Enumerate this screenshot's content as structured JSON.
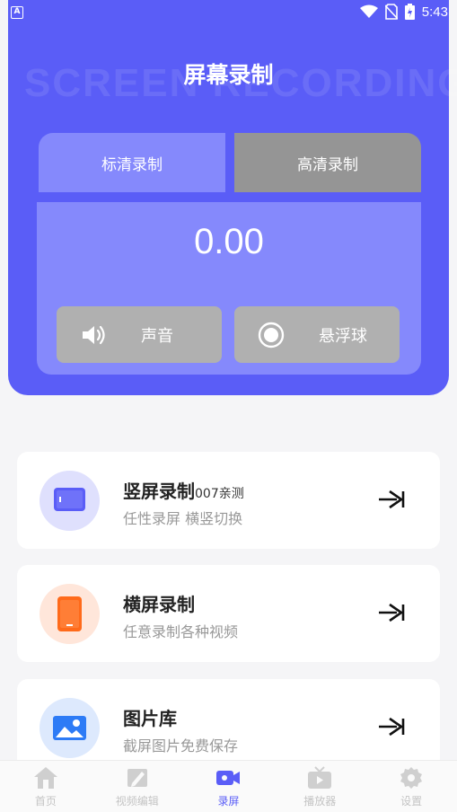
{
  "status_bar": {
    "left_badge": "A",
    "time": "5:43"
  },
  "header": {
    "watermark": "SCREEN RECORDING",
    "title": "屏幕录制",
    "tabs": {
      "sd": "标清录制",
      "hd": "高清录制"
    },
    "timer": "0.00",
    "buttons": {
      "sound": "声音",
      "float": "悬浮球"
    }
  },
  "cards": [
    {
      "title": "竖屏录制",
      "title_suffix": "007亲测",
      "subtitle": "任性录屏 横竖切换",
      "icon": "portrait-screen-icon"
    },
    {
      "title": "横屏录制",
      "subtitle": "任意录制各种视频",
      "icon": "landscape-phone-icon"
    },
    {
      "title": "图片库",
      "subtitle": "截屏图片免费保存",
      "icon": "image-gallery-icon"
    }
  ],
  "nav": [
    {
      "label": "首页",
      "icon": "home-icon"
    },
    {
      "label": "视频编辑",
      "icon": "edit-icon"
    },
    {
      "label": "录屏",
      "icon": "video-camera-icon",
      "active": true
    },
    {
      "label": "播放器",
      "icon": "tv-play-icon"
    },
    {
      "label": "设置",
      "icon": "gear-icon"
    }
  ],
  "colors": {
    "accent": "#5a5df7",
    "panel": "#8589fc",
    "inactive": "#959595",
    "orange": "#ff6a1a",
    "blue": "#2d7bf6"
  }
}
